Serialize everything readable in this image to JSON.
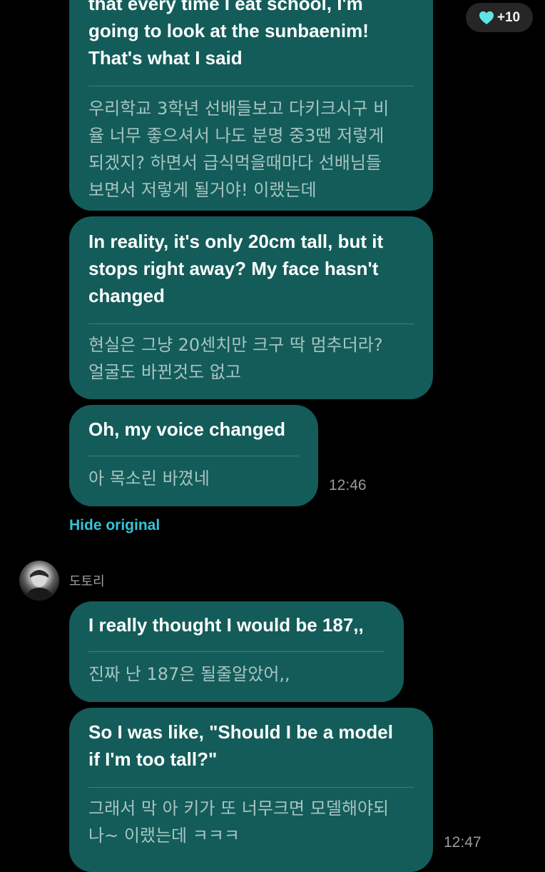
{
  "reaction": {
    "count": "+10",
    "icon": "heart-icon",
    "color": "#5fe3e3"
  },
  "messages_top": [
    {
      "en_lines": [
        "that every time I eat school, I'm",
        "going to look at the sunbaenim!",
        "That's what I said"
      ],
      "ko_lines": [
        "우리학교 3학년 선배들보고 다키크시구 비",
        "율 너무 좋으셔서 나도 분명 중3땐 저렇게",
        "되겠지? 하면서 급식먹을때마다 선배님들",
        "보면서 저렇게 될거야! 이랬는데"
      ]
    },
    {
      "en_lines": [
        "In reality, it's only 20cm tall, but it",
        "stops right away? My face hasn't",
        "changed"
      ],
      "ko_lines": [
        "현실은 그냥 20센치만 크구 딱 멈추더라?",
        "얼굴도 바뀐것도 없고"
      ]
    },
    {
      "en_lines": [
        "Oh, my voice changed"
      ],
      "ko_lines": [
        "아 목소린 바꼈네"
      ],
      "time": "12:46"
    }
  ],
  "hide_original": "Hide original",
  "sender": {
    "name": "도토리"
  },
  "messages_bottom": [
    {
      "en_lines": [
        "I really thought I would be 187,,"
      ],
      "ko_lines": [
        "진짜 난 187은 될줄알았어,,"
      ]
    },
    {
      "en_lines": [
        "So I was like, \"Should I be a model",
        "if I'm too tall?\""
      ],
      "ko_lines": [
        "그래서 막 아 키가 또 너무크면 모델해야되",
        "나~ 이랬는데 ㅋㅋㅋ"
      ],
      "time": "12:47"
    }
  ],
  "colors": {
    "background": "#000000",
    "bubble": "#135c59",
    "translation_text": "#a7c4c2",
    "link": "#35c4d8"
  }
}
